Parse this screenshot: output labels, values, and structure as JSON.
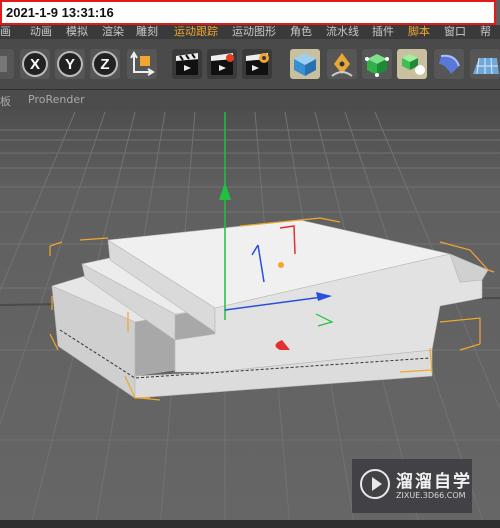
{
  "timestamp": "2021-1-9 13:31:16",
  "menu": [
    "画",
    "动画",
    "模拟",
    "渲染",
    "雕刻",
    "运动跟踪",
    "运动图形",
    "角色",
    "流水线",
    "插件",
    "脚本",
    "窗口",
    "帮"
  ],
  "active_menu": "运动跟踪",
  "toolbar": {
    "axis_x": "X",
    "axis_y": "Y",
    "axis_z": "Z"
  },
  "tabs": [
    "板",
    "ProRender"
  ],
  "watermark": {
    "title": "溜溜自学",
    "subtitle": "ZIXUE.3D66.COM"
  },
  "colors": {
    "accent_orange": "#f0a630",
    "axis_x": "#e23030",
    "axis_y": "#20c040",
    "axis_z": "#2850e0",
    "timestamp_border": "#e21a1a"
  }
}
